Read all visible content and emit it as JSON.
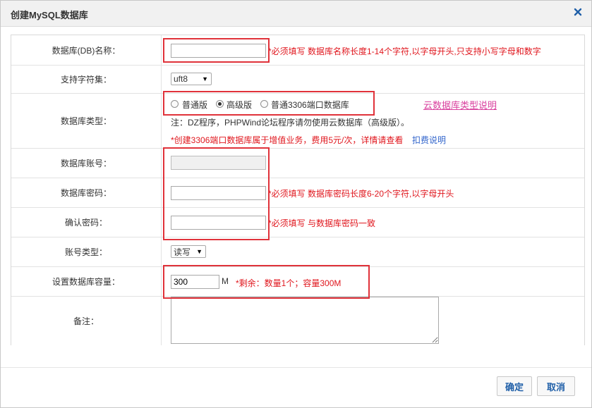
{
  "dialog": {
    "title": "创建MySQL数据库",
    "close_icon": "close-icon"
  },
  "colors": {
    "accent_blue": "#1f5fa8",
    "warning_red": "#e0161d",
    "highlight_box": "#e0323a",
    "link_pink": "#d9419e"
  },
  "form": {
    "db_name": {
      "label": "数据库(DB)名称：",
      "value": "",
      "hint": "*必须填写 数据库名称长度1-14个字符,以字母开头,只支持小写字母和数字"
    },
    "charset": {
      "label": "支持字符集：",
      "selected": "uft8"
    },
    "db_type": {
      "label": "数据库类型：",
      "options": [
        "普通版",
        "高级版",
        "普通3306端口数据库"
      ],
      "selected_index": 1,
      "help_link": "云数据库类型说明",
      "note": "注：DZ程序，PHPWind论坛程序请勿使用云数据库（高级版）。",
      "warning": "*创建3306端口数据库属于增值业务，费用5元/次，详情请查看",
      "billing_link": "扣费说明"
    },
    "account": {
      "label": "数据库账号：",
      "value": ""
    },
    "password": {
      "label": "数据库密码：",
      "value": "",
      "hint": "*必须填写 数据库密码长度6-20个字符,以字母开头"
    },
    "confirm": {
      "label": "确认密码：",
      "value": "",
      "hint": "*必须填写 与数据库密码一致"
    },
    "account_type": {
      "label": "账号类型：",
      "selected": "读写"
    },
    "capacity": {
      "label": "设置数据库容量：",
      "value": "300",
      "unit": "M",
      "remaining": "*剩余：数量1个；容量300M"
    },
    "remark": {
      "label": "备注：",
      "value": ""
    }
  },
  "buttons": {
    "confirm": "确定",
    "cancel": "取消"
  }
}
